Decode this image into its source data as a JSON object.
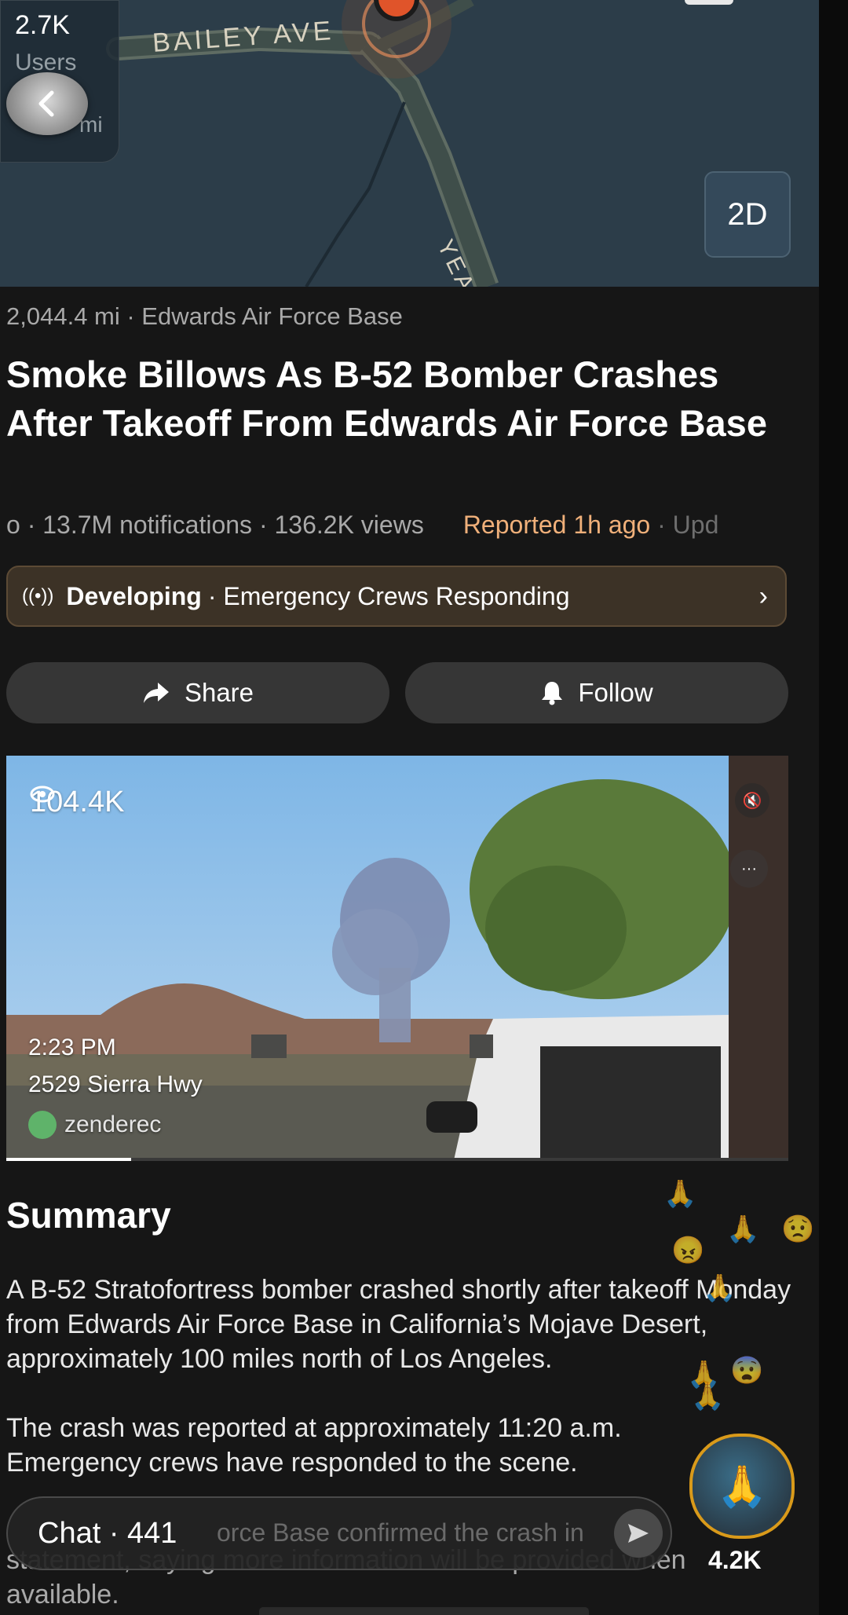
{
  "map": {
    "count": "2.7K",
    "sub1": "Users",
    "sub2": "mi",
    "street_primary": "BAILEY AVE",
    "street_secondary": "YEA",
    "view_toggle": "2D"
  },
  "article": {
    "location_line": "2,044.4 mi · Edwards Air Force Base",
    "headline": "Smoke Billows As B-52 Bomber Crashes After Takeoff From Edwards Air Force Base",
    "stats_prefix": "o · 13.7M notifications · 136.2K views",
    "reported": "Reported 1h ago",
    "updated": " · Upd",
    "banner": {
      "bold": "Developing",
      "text": "· Emergency Crews Responding"
    },
    "share_label": "Share",
    "follow_label": "Follow"
  },
  "video": {
    "views": "104.4K",
    "time": "2:23 PM",
    "address": "2529 Sierra Hwy",
    "user": "zenderec",
    "progress": 0.16
  },
  "summary": {
    "title": "Summary",
    "p1": "A B-52 Stratofortress bomber crashed shortly after takeoff Monday from Edwards Air Force Base in California’s Mojave Desert, approximately 100 miles north of Los Angeles.",
    "p2": "The crash was reported at approximately 11:20 a.m. Emergency crews have responded to the scene.",
    "p3": "statement, saying more information will be provided when available."
  },
  "chat": {
    "label": "Chat · 441",
    "ghost_text": "orce Base confirmed the crash in",
    "reaction_count": "4.2K"
  },
  "colors": {
    "background": "#161616",
    "map": "#2c3d49",
    "accent_reported": "#f0b07a",
    "banner_bg": "#3c3226"
  }
}
